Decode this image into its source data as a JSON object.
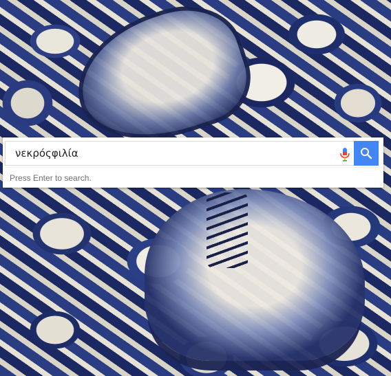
{
  "background": {
    "image_name": "porcelain-boots-wallpaper",
    "colors": {
      "porcelain_blue": "#22346f",
      "porcelain_white": "#e9e6dc"
    }
  },
  "search": {
    "query": "νεκρόςφιλία",
    "hint": "Press Enter to search.",
    "mic_icon": "microphone-icon",
    "search_icon": "magnifier-icon"
  },
  "colors": {
    "search_button": "#4285f4",
    "mic_red": "#ea4335",
    "mic_blue": "#4285f4",
    "hint_text": "#707070"
  }
}
